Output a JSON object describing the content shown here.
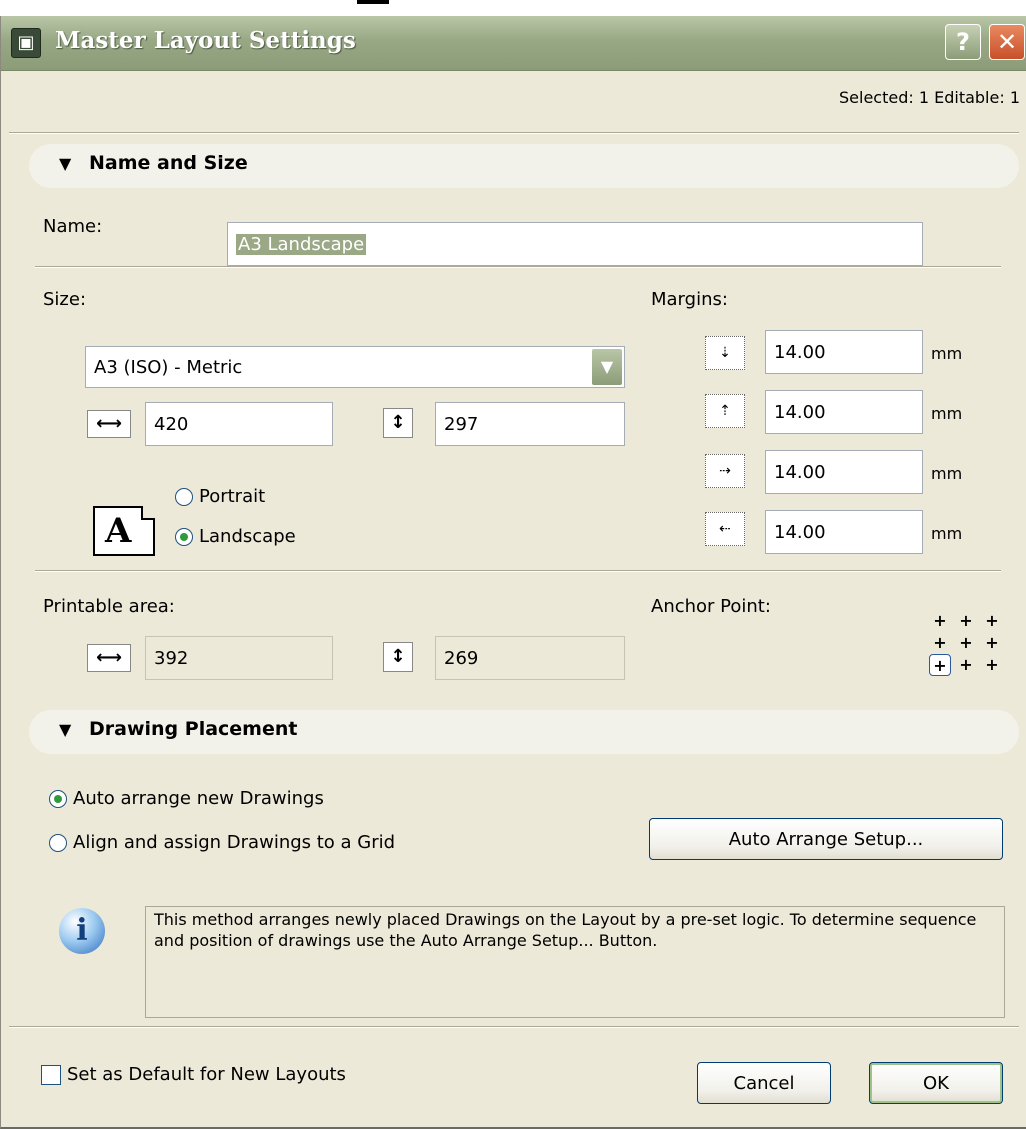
{
  "window": {
    "title": "Master Layout Settings",
    "help_label": "?",
    "close_label": "✕"
  },
  "selected_info": "Selected: 1 Editable: 1",
  "sections": {
    "name_size": "Name and Size",
    "drawing_placement": "Drawing Placement"
  },
  "name": {
    "label": "Name:",
    "value": "A3 Landscape"
  },
  "size": {
    "label": "Size:",
    "selected": "A3 (ISO) - Metric",
    "width": "420",
    "height": "297"
  },
  "orientation": {
    "paper_letter": "A",
    "portrait": "Portrait",
    "landscape": "Landscape",
    "selected": "landscape"
  },
  "margins": {
    "label": "Margins:",
    "unit": "mm",
    "top": "14.00",
    "bottom": "14.00",
    "left": "14.00",
    "right": "14.00"
  },
  "printable_area": {
    "label": "Printable area:",
    "width": "392",
    "height": "269"
  },
  "anchor_point": {
    "label": "Anchor Point:",
    "selected": "bottom-left"
  },
  "placement": {
    "auto_arrange": "Auto arrange new Drawings",
    "align_grid": "Align and assign Drawings to a Grid",
    "selected": "auto_arrange",
    "setup_button": "Auto Arrange Setup...",
    "info_text": "This method arranges newly placed Drawings on the Layout by a pre-set logic. To determine sequence and position of drawings use the Auto Arrange Setup... Button."
  },
  "footer": {
    "default_checkbox": "Set as Default for New Layouts",
    "cancel": "Cancel",
    "ok": "OK"
  }
}
